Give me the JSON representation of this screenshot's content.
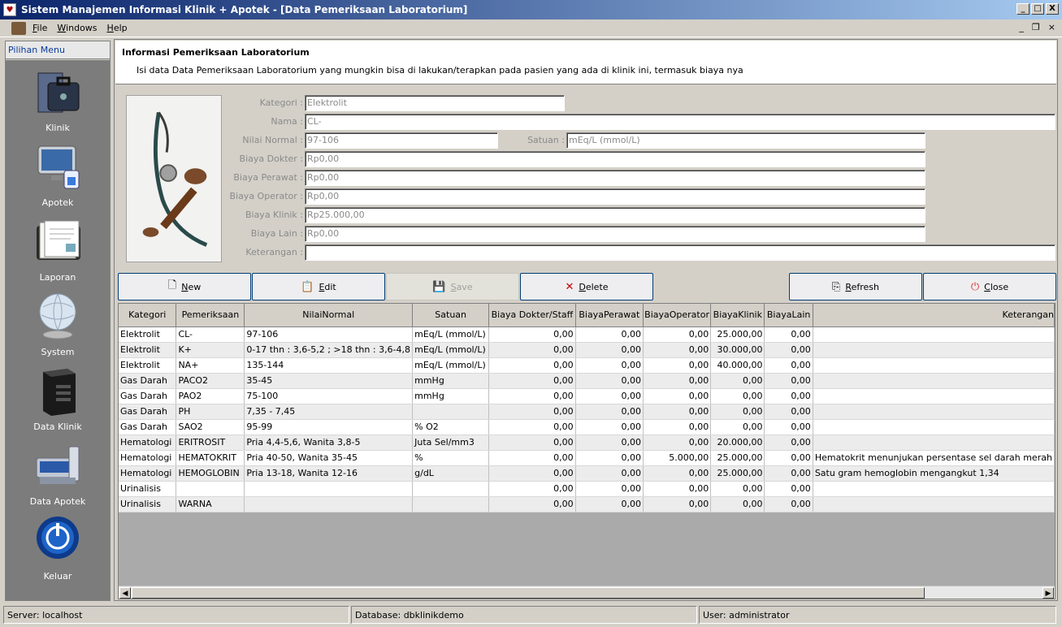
{
  "window": {
    "title": "Sistem Manajemen Informasi Klinik + Apotek - [Data Pemeriksaan Laboratorium]",
    "min": "_",
    "max": "□",
    "close": "X"
  },
  "menu": {
    "file": "File",
    "windows": "Windows",
    "help": "Help",
    "mdi_min": "_",
    "mdi_restore": "❐",
    "mdi_close": "×"
  },
  "sidebar": {
    "header": "Pilihan Menu",
    "items": [
      {
        "label": "Klinik",
        "icon": "briefcase-icon"
      },
      {
        "label": "Apotek",
        "icon": "monitor-icon"
      },
      {
        "label": "Laporan",
        "icon": "documents-icon"
      },
      {
        "label": "System",
        "icon": "globe-icon"
      },
      {
        "label": "Data Klinik",
        "icon": "server-icon"
      },
      {
        "label": "Data Apotek",
        "icon": "database-icon"
      },
      {
        "label": "Keluar",
        "icon": "power-icon"
      }
    ]
  },
  "info": {
    "title": "Informasi Pemeriksaan Laboratorium",
    "description": "Isi data Data Pemeriksaan Laboratorium yang mungkin bisa di lakukan/terapkan pada pasien yang ada di klinik ini, termasuk biaya nya"
  },
  "form": {
    "kategori_label": "Kategori :",
    "kategori": "Elektrolit",
    "nama_label": "Nama :",
    "nama": "CL-",
    "nilai_label": "Nilai Normal :",
    "nilai": "97-106",
    "satuan_label": "Satuan :",
    "satuan": "mEq/L (mmol/L)",
    "dokter_label": "Biaya Dokter :",
    "dokter": "Rp0,00",
    "perawat_label": "Biaya Perawat :",
    "perawat": "Rp0,00",
    "operator_label": "Biaya Operator :",
    "operator": "Rp0,00",
    "klinik_label": "Biaya Klinik :",
    "klinik": "Rp25.000,00",
    "lain_label": "Biaya Lain :",
    "lain": "Rp0,00",
    "ket_label": "Keterangan :",
    "ket": ""
  },
  "buttons": {
    "new": "New",
    "edit": "Edit",
    "save": "Save",
    "delete": "Delete",
    "refresh": "Refresh",
    "close": "Close"
  },
  "table": {
    "headers": [
      "Kategori",
      "Pemeriksaan",
      "NilaiNormal",
      "Satuan",
      "Biaya Dokter/Staff",
      "BiayaPerawat",
      "BiayaOperator",
      "BiayaKlinik",
      "BiayaLain",
      "Keterangan"
    ],
    "rows": [
      [
        "Elektrolit",
        "CL-",
        "97-106",
        "mEq/L (mmol/L)",
        "0,00",
        "0,00",
        "0,00",
        "25.000,00",
        "0,00",
        ""
      ],
      [
        "Elektrolit",
        "K+",
        "0-17 thn : 3,6-5,2 ; >18 thn : 3,6-4,8",
        "mEq/L (mmol/L)",
        "0,00",
        "0,00",
        "0,00",
        "30.000,00",
        "0,00",
        ""
      ],
      [
        "Elektrolit",
        "NA+",
        "135-144",
        "mEq/L (mmol/L)",
        "0,00",
        "0,00",
        "0,00",
        "40.000,00",
        "0,00",
        ""
      ],
      [
        "Gas Darah",
        "PACO2",
        "35-45",
        "mmHg",
        "0,00",
        "0,00",
        "0,00",
        "0,00",
        "0,00",
        ""
      ],
      [
        "Gas Darah",
        "PAO2",
        "75-100",
        "mmHg",
        "0,00",
        "0,00",
        "0,00",
        "0,00",
        "0,00",
        ""
      ],
      [
        "Gas Darah",
        "PH",
        "7,35 - 7,45",
        "",
        "0,00",
        "0,00",
        "0,00",
        "0,00",
        "0,00",
        ""
      ],
      [
        "Gas Darah",
        "SAO2",
        "95-99",
        "% O2",
        "0,00",
        "0,00",
        "0,00",
        "0,00",
        "0,00",
        ""
      ],
      [
        "Hematologi",
        "ERITROSIT",
        "Pria 4,4-5,6, Wanita 3,8-5",
        "Juta Sel/mm3",
        "0,00",
        "0,00",
        "0,00",
        "20.000,00",
        "0,00",
        ""
      ],
      [
        "Hematologi",
        "HEMATOKRIT",
        "Pria 40-50, Wanita 35-45",
        "%",
        "0,00",
        "0,00",
        "5.000,00",
        "25.000,00",
        "0,00",
        "Hematokrit menunjukan persentase sel darah merah"
      ],
      [
        "Hematologi",
        "HEMOGLOBIN",
        "Pria 13-18, Wanita 12-16",
        "g/dL",
        "0,00",
        "0,00",
        "0,00",
        "25.000,00",
        "0,00",
        "Satu gram hemoglobin mengangkut 1,34"
      ],
      [
        "Urinalisis",
        "",
        "",
        "",
        "0,00",
        "0,00",
        "0,00",
        "0,00",
        "0,00",
        ""
      ],
      [
        "Urinalisis",
        "WARNA",
        "",
        "",
        "0,00",
        "0,00",
        "0,00",
        "0,00",
        "0,00",
        ""
      ]
    ]
  },
  "status": {
    "server": "Server:  localhost",
    "database": "Database:  dbklinikdemo",
    "user": "User:  administrator"
  }
}
